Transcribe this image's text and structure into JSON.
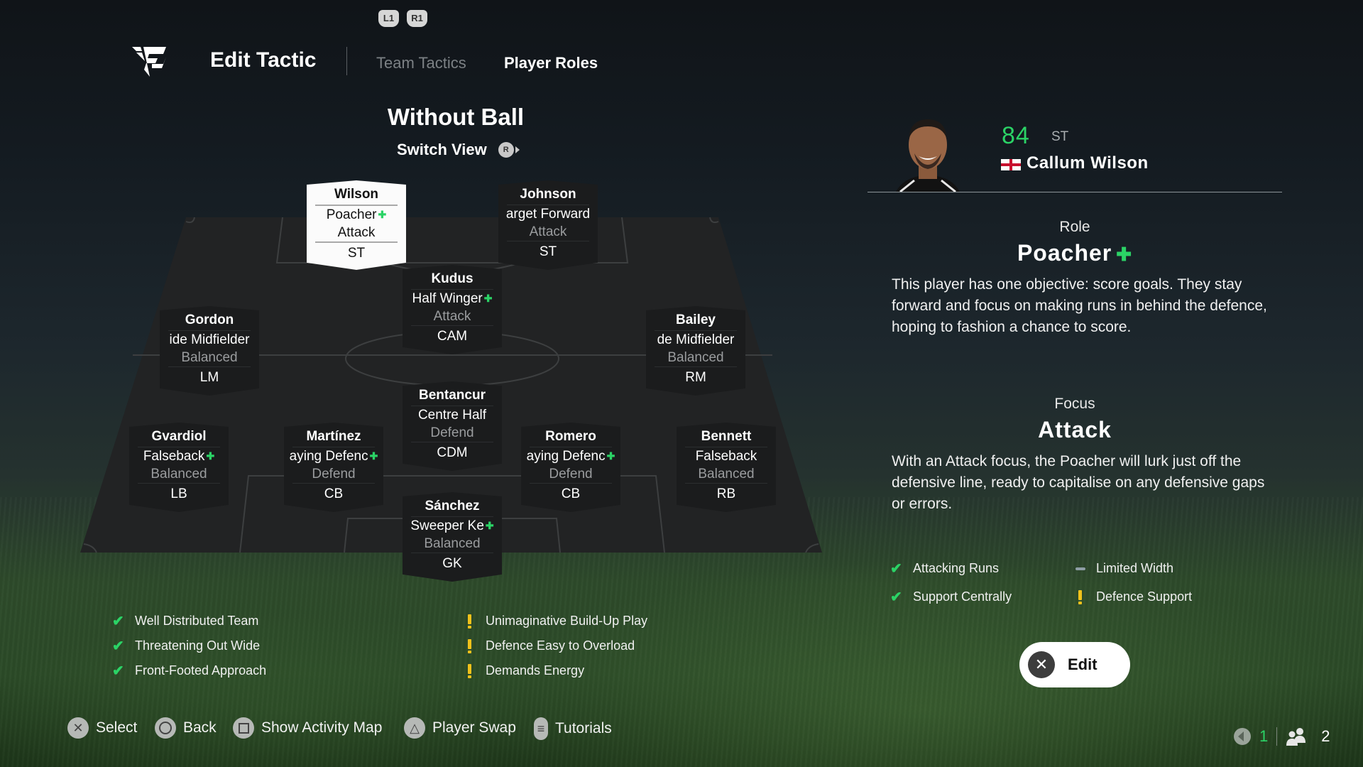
{
  "header": {
    "bumper_left": "L1",
    "bumper_right": "R1",
    "title": "Edit Tactic",
    "tabs": [
      {
        "label": "Team Tactics",
        "active": false
      },
      {
        "label": "Player Roles",
        "active": true
      }
    ]
  },
  "view": {
    "title": "Without Ball",
    "switch_label": "Switch View",
    "switch_button": "R"
  },
  "formation": [
    {
      "name": "Wilson",
      "role": "Poacher",
      "plus": true,
      "focus": "Attack",
      "position": "ST",
      "selected": true
    },
    {
      "name": "Johnson",
      "role": "arget Forward",
      "plus": false,
      "focus": "Attack",
      "position": "ST",
      "selected": false
    },
    {
      "name": "Kudus",
      "role": "Half Winger",
      "plus": true,
      "focus": "Attack",
      "position": "CAM",
      "selected": false
    },
    {
      "name": "Gordon",
      "role": "ide Midfielder",
      "plus": false,
      "focus": "Balanced",
      "position": "LM",
      "selected": false
    },
    {
      "name": "Bailey",
      "role": "de Midfielder",
      "plus": false,
      "focus": "Balanced",
      "position": "RM",
      "selected": false
    },
    {
      "name": "Bentancur",
      "role": "Centre Half",
      "plus": false,
      "focus": "Defend",
      "position": "CDM",
      "selected": false
    },
    {
      "name": "Gvardiol",
      "role": "Falseback",
      "plus": true,
      "focus": "Balanced",
      "position": "LB",
      "selected": false
    },
    {
      "name": "Martínez",
      "role": "aying Defenc",
      "plus": true,
      "focus": "Defend",
      "position": "CB",
      "selected": false
    },
    {
      "name": "Romero",
      "role": "aying Defenc",
      "plus": true,
      "focus": "Defend",
      "position": "CB",
      "selected": false
    },
    {
      "name": "Bennett",
      "role": "Falseback",
      "plus": false,
      "focus": "Balanced",
      "position": "RB",
      "selected": false
    },
    {
      "name": "Sánchez",
      "role": "Sweeper Ke",
      "plus": true,
      "focus": "Balanced",
      "position": "GK",
      "selected": false
    }
  ],
  "team_traits": {
    "strengths": [
      "Well Distributed Team",
      "Threatening Out Wide",
      "Front-Footed Approach"
    ],
    "weaknesses": [
      "Unimaginative Build-Up Play",
      "Defence Easy to Overload",
      "Demands Energy"
    ]
  },
  "player_panel": {
    "rating": "84",
    "position": "ST",
    "nationality": "England",
    "name": "Callum Wilson",
    "role_label": "Role",
    "role_value": "Poacher",
    "role_plus": true,
    "role_description": "This player has one objective: score goals. They stay forward and focus on making runs in behind the defence, hoping to fashion a chance to score.",
    "focus_label": "Focus",
    "focus_value": "Attack",
    "focus_description": "With an Attack focus, the Poacher will lurk just off the defensive line, ready to capitalise on any defensive gaps or errors.",
    "traits": [
      {
        "label": "Attacking Runs",
        "status": "positive"
      },
      {
        "label": "Limited Width",
        "status": "neutral"
      },
      {
        "label": "Support Centrally",
        "status": "positive"
      },
      {
        "label": "Defence Support",
        "status": "warning"
      }
    ],
    "edit_label": "Edit"
  },
  "controls": [
    {
      "icon": "cross-button-icon",
      "label": "Select"
    },
    {
      "icon": "circle-button-icon",
      "label": "Back"
    },
    {
      "icon": "square-button-icon",
      "label": "Show Activity Map"
    },
    {
      "icon": "triangle-button-icon",
      "label": "Player Swap"
    },
    {
      "icon": "options-button-icon",
      "label": "Tutorials"
    }
  ],
  "status_bar": {
    "mic_count": "1",
    "party_count": "2"
  },
  "colors": {
    "accent_green": "#2bd366",
    "warning_yellow": "#f1c21b"
  }
}
